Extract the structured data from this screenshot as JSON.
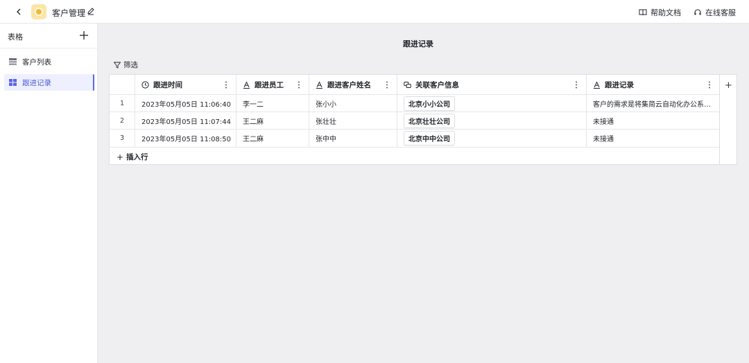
{
  "topbar": {
    "app_title": "客户管理",
    "help_label": "帮助文档",
    "service_label": "在线客服"
  },
  "sidebar": {
    "title": "表格",
    "items": [
      {
        "label": "客户列表",
        "active": false
      },
      {
        "label": "跟进记录",
        "active": true
      }
    ]
  },
  "main": {
    "title": "跟进记录",
    "filter_label": "筛选",
    "insert_row_label": "插入行",
    "accent_color": "#5b66e0",
    "columns": [
      {
        "label": "跟进时间",
        "icon": "clock-icon"
      },
      {
        "label": "跟进员工",
        "icon": "text-field-icon"
      },
      {
        "label": "跟进客户姓名",
        "icon": "text-field-icon"
      },
      {
        "label": "关联客户信息",
        "icon": "link-field-icon"
      },
      {
        "label": "跟进记录",
        "icon": "text-field-icon"
      }
    ],
    "rows": [
      {
        "num": "1",
        "time": "2023年05月05日 11:06:40",
        "employee": "李一二",
        "customer": "张小小",
        "company": "北京小小公司",
        "record": "客户的需求是将集简云自动化办公系…"
      },
      {
        "num": "2",
        "time": "2023年05月05日 11:07:44",
        "employee": "王二麻",
        "customer": "张壮壮",
        "company": "北京壮壮公司",
        "record": "未接通"
      },
      {
        "num": "3",
        "time": "2023年05月05日 11:08:50",
        "employee": "王二麻",
        "customer": "张中中",
        "company": "北京中中公司",
        "record": "未接通"
      }
    ]
  }
}
